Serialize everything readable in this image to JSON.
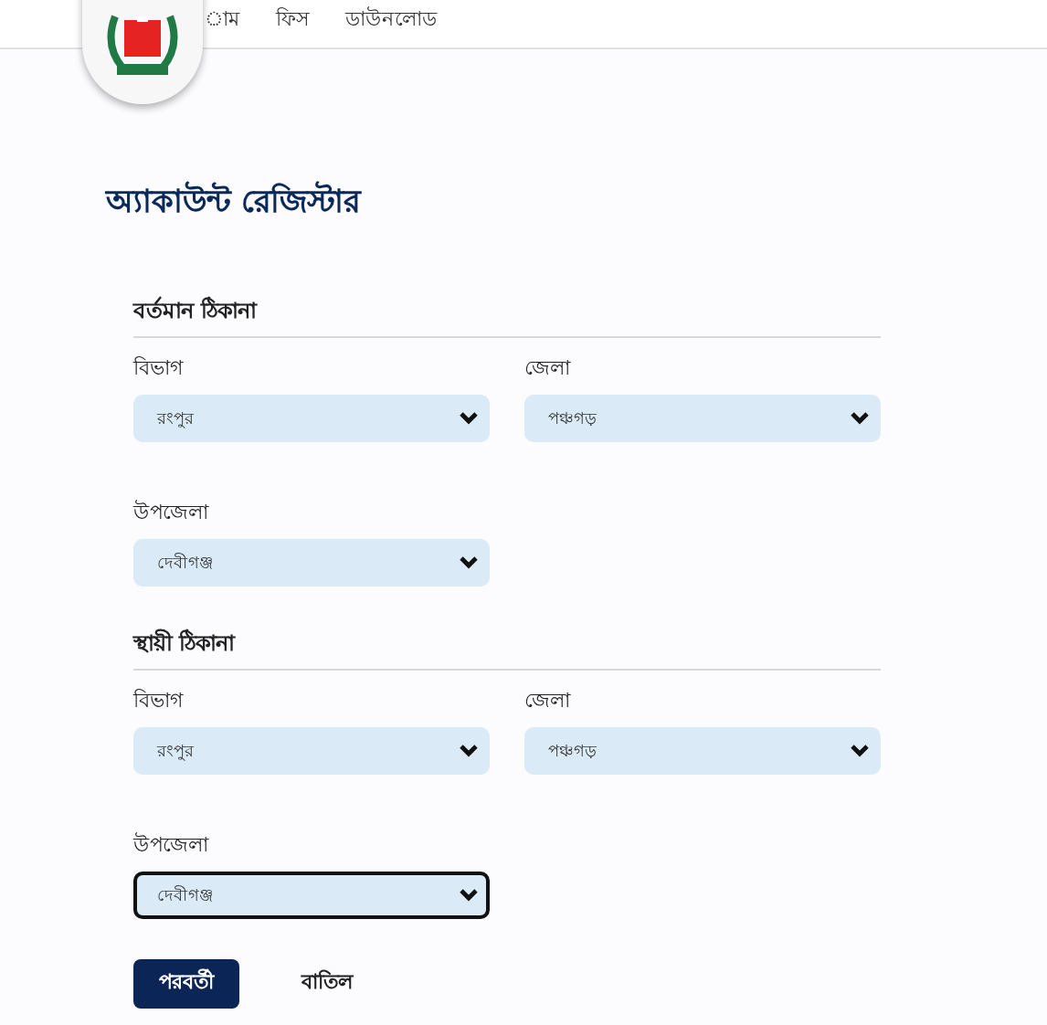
{
  "nav": [
    {
      "label": "াম"
    },
    {
      "label": "ফিস"
    },
    {
      "label": "ডাউনলোড"
    }
  ],
  "title": "অ্যাকাউন্ট রেজিস্টার",
  "sections": [
    {
      "heading": "বর্তমান ঠিকানা",
      "fields": [
        {
          "label": "বিভাগ",
          "value": "রংপুর",
          "focused": false
        },
        {
          "label": "জেলা",
          "value": "পঞ্চগড়",
          "focused": false
        },
        {
          "label": "উপজেলা",
          "value": "দেবীগঞ্জ",
          "focused": false
        }
      ]
    },
    {
      "heading": "স্থায়ী ঠিকানা",
      "fields": [
        {
          "label": "বিভাগ",
          "value": "রংপুর",
          "focused": false
        },
        {
          "label": "জেলা",
          "value": "পঞ্চগড়",
          "focused": false
        },
        {
          "label": "উপজেলা",
          "value": "দেবীগঞ্জ",
          "focused": true
        }
      ]
    }
  ],
  "buttons": [
    {
      "label": "পরবর্তী",
      "kind": "primary"
    },
    {
      "label": "বাতিল",
      "kind": "plain"
    }
  ]
}
